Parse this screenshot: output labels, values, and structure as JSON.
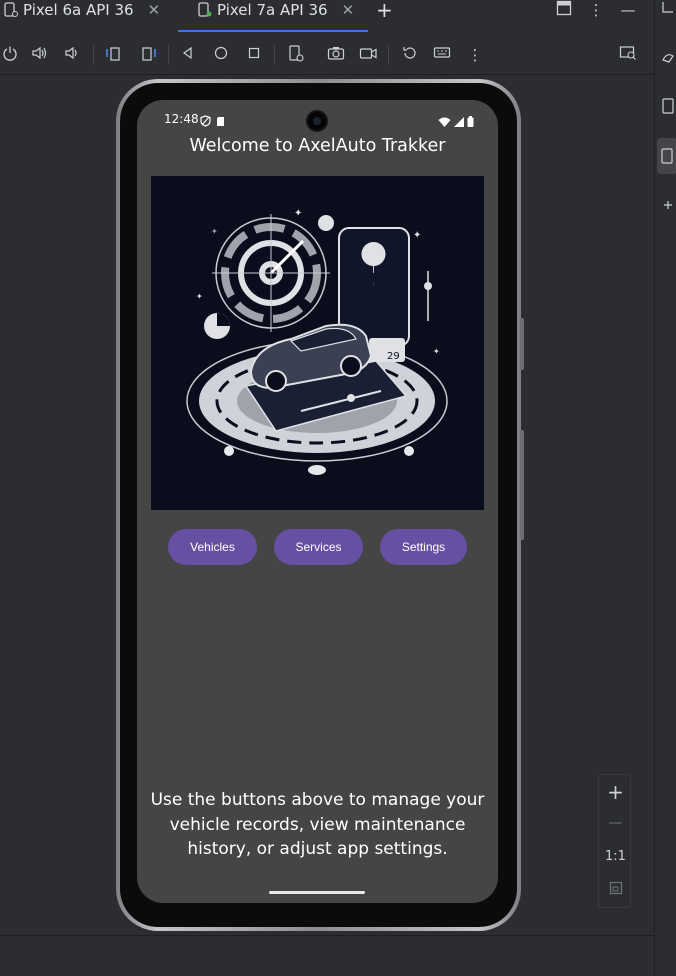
{
  "ide": {
    "tabs": [
      {
        "label": "Pixel 6a API 36",
        "close": "✕"
      },
      {
        "label": "Pixel 7a API 36",
        "close": "✕"
      }
    ],
    "new_tab": "+",
    "zoom": {
      "plus": "+",
      "minus": "—",
      "one_to_one": "1:1"
    }
  },
  "device": {
    "status": {
      "time": "12:48"
    },
    "app": {
      "title": "Welcome to AxelAuto Trakker",
      "hero_date": "29",
      "buttons": [
        {
          "label": "Vehicles"
        },
        {
          "label": "Services"
        },
        {
          "label": "Settings"
        }
      ],
      "help_text": "Use the buttons above to manage your vehicle records, view maintenance history, or adjust app settings."
    }
  },
  "colors": {
    "ide_bg": "#2b2d30",
    "screen_bg": "#454545",
    "button_bg": "#6750a4",
    "hero_bg": "#0a0d1c",
    "tab_accent": "#3574f0"
  },
  "icons": {
    "tab_device": "device-icon",
    "toolbar": [
      "power-icon",
      "volume-up-icon",
      "volume-down-icon",
      "rotate-left-icon",
      "rotate-right-icon",
      "back-icon",
      "home-icon",
      "overview-icon",
      "device-settings-icon",
      "camera-icon",
      "screenrecord-icon",
      "reset-icon",
      "keyboard-icon",
      "more-icon",
      "display-search-icon"
    ]
  }
}
